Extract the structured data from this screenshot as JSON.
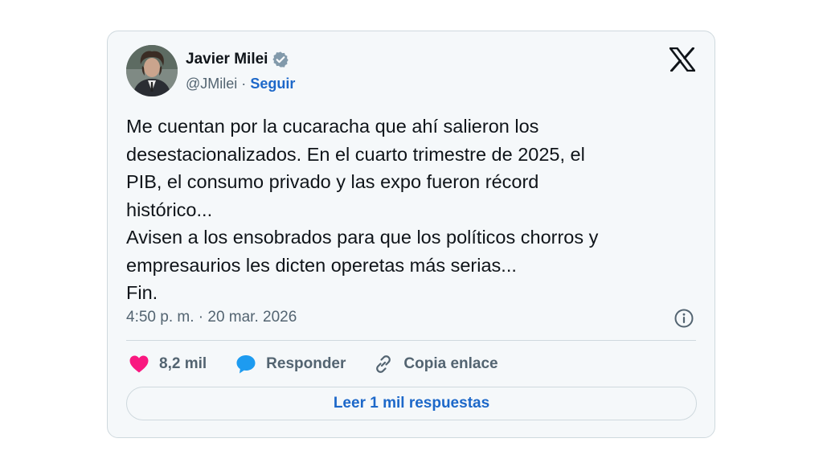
{
  "author": {
    "name": "Javier Milei",
    "handle": "@JMilei",
    "separator": "·",
    "follow_label": "Seguir",
    "verified": true
  },
  "icons": {
    "avatar": "profile-photo",
    "verified": "verified-badge-icon",
    "brand": "x-logo-icon",
    "info": "info-icon",
    "like": "heart-icon",
    "reply": "speech-bubble-icon",
    "copy": "link-icon"
  },
  "tweet": {
    "text": "Me cuentan por la cucaracha que ahí salieron los\ndesestacionalizados. En el cuarto trimestre de 2025, el\nPIB, el consumo privado y las expo fueron récord\nhistórico...\nAvisen a los ensobrados para que los políticos chorros y\nempresaurios les dicten operetas más serias...\nFin.",
    "timestamp": "4:50 p. m. · 20 mar. 2026"
  },
  "actions": {
    "likes": "8,2 mil",
    "reply_label": "Responder",
    "copy_label": "Copia enlace"
  },
  "read_replies_label": "Leer 1 mil respuestas",
  "colors": {
    "link": "#1d68c9",
    "heart": "#f91880",
    "reply_bubble": "#1d9bf0",
    "verified": "#829aab",
    "card_bg": "#f5f8fa",
    "border": "#cfd9de",
    "secondary_text": "#536471"
  }
}
